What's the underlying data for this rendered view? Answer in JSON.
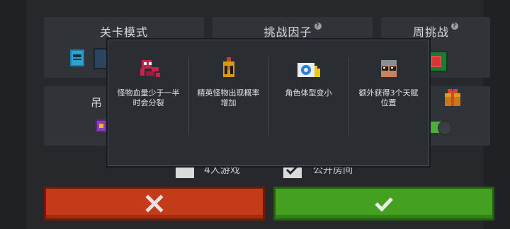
{
  "panels": {
    "level_mode_title": "关卡模式",
    "challenge_factors_title": "挑战因子",
    "weekly_challenge_title": "周挑战",
    "help_glyph": "?",
    "partial_label": "吊"
  },
  "popup": {
    "factors": [
      {
        "icon": "red-tentacle-monster-icon",
        "text": "怪物血量少于一半时会分裂"
      },
      {
        "icon": "golden-spartan-helmet-icon",
        "text": "精英怪物出现概率增加"
      },
      {
        "icon": "swirl-wave-icon",
        "text": "角色体型变小"
      },
      {
        "icon": "sunglasses-character-icon",
        "text": "额外获得3个天赋位置"
      }
    ]
  },
  "options": {
    "players_label": "4人游戏",
    "public_room_label": "公开房间"
  },
  "weekly": {
    "toggle_on": true
  },
  "colors": {
    "cancel_red": "#c43b1a",
    "confirm_green": "#44a021",
    "background": "#26282c"
  }
}
